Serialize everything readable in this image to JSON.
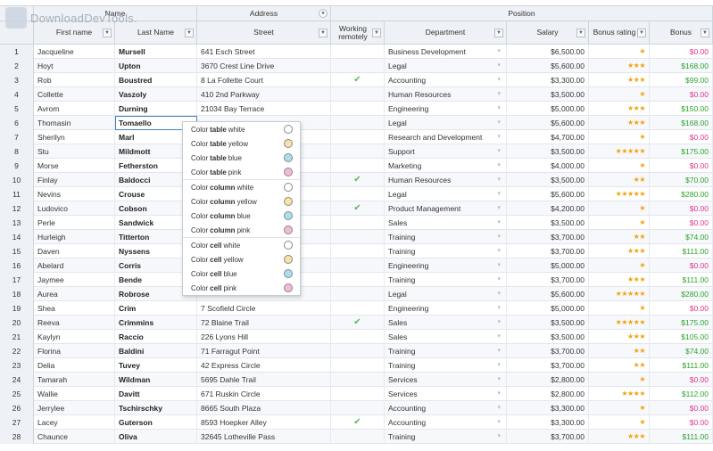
{
  "header": {
    "group_name": "Name",
    "group_address": "Address",
    "group_position": "Position",
    "columns": [
      "First name",
      "Last Name",
      "Street",
      "Working remotely",
      "Department",
      "Salary",
      "Bonus rating",
      "Bonus"
    ]
  },
  "watermark": "DownloadDevTools.",
  "colors": {
    "bonus_positive": "#2aa52a",
    "bonus_zero": "#e0348c",
    "star": "#f0a30a",
    "check": "#5cb85c"
  },
  "rows": [
    {
      "n": "1",
      "first": "Jacqueline",
      "last": "Mursell",
      "street": "641 Esch Street",
      "remote": false,
      "dept": "Business Development",
      "salary": "$6,500.00",
      "stars": "★",
      "bonus": "$0.00"
    },
    {
      "n": "2",
      "first": "Hoyt",
      "last": "Upton",
      "street": "3670 Crest Line Drive",
      "remote": false,
      "dept": "Legal",
      "salary": "$5,600.00",
      "stars": "★★★",
      "bonus": "$168.00"
    },
    {
      "n": "3",
      "first": "Rob",
      "last": "Boustred",
      "street": "8 La Follette Court",
      "remote": true,
      "dept": "Accounting",
      "salary": "$3,300.00",
      "stars": "★★★",
      "bonus": "$99.00"
    },
    {
      "n": "4",
      "first": "Collette",
      "last": "Vaszoly",
      "street": "410 2nd Parkway",
      "remote": false,
      "dept": "Human Resources",
      "salary": "$3,500.00",
      "stars": "★",
      "bonus": "$0.00"
    },
    {
      "n": "5",
      "first": "Avrom",
      "last": "Durning",
      "street": "21034 Bay Terrace",
      "remote": false,
      "dept": "Engineering",
      "salary": "$5,000.00",
      "stars": "★★★",
      "bonus": "$150.00"
    },
    {
      "n": "6",
      "first": "Thomasin",
      "last": "Tomaello",
      "street": "",
      "remote": false,
      "dept": "Legal",
      "salary": "$5,600.00",
      "stars": "★★★",
      "bonus": "$168.00"
    },
    {
      "n": "7",
      "first": "Sherilyn",
      "last": "Marl",
      "street": "",
      "remote": false,
      "dept": "Research and Development",
      "salary": "$4,700.00",
      "stars": "★",
      "bonus": "$0.00"
    },
    {
      "n": "8",
      "first": "Stu",
      "last": "Mildmott",
      "street": "",
      "remote": false,
      "dept": "Support",
      "salary": "$3,500.00",
      "stars": "★★★★★",
      "bonus": "$175.00"
    },
    {
      "n": "9",
      "first": "Morse",
      "last": "Fetherston",
      "street": "",
      "remote": false,
      "dept": "Marketing",
      "salary": "$4,000.00",
      "stars": "★",
      "bonus": "$0.00"
    },
    {
      "n": "10",
      "first": "Finlay",
      "last": "Baldocci",
      "street": "",
      "remote": true,
      "dept": "Human Resources",
      "salary": "$3,500.00",
      "stars": "★★",
      "bonus": "$70.00"
    },
    {
      "n": "11",
      "first": "Nevins",
      "last": "Crouse",
      "street": "",
      "remote": false,
      "dept": "Legal",
      "salary": "$5,600.00",
      "stars": "★★★★★",
      "bonus": "$280.00"
    },
    {
      "n": "12",
      "first": "Ludovico",
      "last": "Cobson",
      "street": "",
      "remote": true,
      "dept": "Product Management",
      "salary": "$4,200.00",
      "stars": "★",
      "bonus": "$0.00"
    },
    {
      "n": "13",
      "first": "Perle",
      "last": "Sandwick",
      "street": "",
      "remote": false,
      "dept": "Sales",
      "salary": "$3,500.00",
      "stars": "★",
      "bonus": "$0.00"
    },
    {
      "n": "14",
      "first": "Hurleigh",
      "last": "Titterton",
      "street": "",
      "remote": false,
      "dept": "Training",
      "salary": "$3,700.00",
      "stars": "★★",
      "bonus": "$74.00"
    },
    {
      "n": "15",
      "first": "Daven",
      "last": "Nyssens",
      "street": "",
      "remote": false,
      "dept": "Training",
      "salary": "$3,700.00",
      "stars": "★★★",
      "bonus": "$111.00"
    },
    {
      "n": "16",
      "first": "Abelard",
      "last": "Corris",
      "street": "",
      "remote": false,
      "dept": "Engineering",
      "salary": "$5,000.00",
      "stars": "★",
      "bonus": "$0.00"
    },
    {
      "n": "17",
      "first": "Jaymee",
      "last": "Bende",
      "street": "",
      "remote": false,
      "dept": "Training",
      "salary": "$3,700.00",
      "stars": "★★★",
      "bonus": "$111.00"
    },
    {
      "n": "18",
      "first": "Aurea",
      "last": "Robrose",
      "street": "",
      "remote": false,
      "dept": "Legal",
      "salary": "$5,600.00",
      "stars": "★★★★★",
      "bonus": "$280.00"
    },
    {
      "n": "19",
      "first": "Shea",
      "last": "Crim",
      "street": "7 Scofield Circle",
      "remote": false,
      "dept": "Engineering",
      "salary": "$5,000.00",
      "stars": "★",
      "bonus": "$0.00"
    },
    {
      "n": "20",
      "first": "Reeva",
      "last": "Crimmins",
      "street": "72 Blaine Trail",
      "remote": true,
      "dept": "Sales",
      "salary": "$3,500.00",
      "stars": "★★★★★",
      "bonus": "$175.00"
    },
    {
      "n": "21",
      "first": "Kaylyn",
      "last": "Raccio",
      "street": "226 Lyons Hill",
      "remote": false,
      "dept": "Sales",
      "salary": "$3,500.00",
      "stars": "★★★",
      "bonus": "$105.00"
    },
    {
      "n": "22",
      "first": "Florina",
      "last": "Baldini",
      "street": "71 Farragut Point",
      "remote": false,
      "dept": "Training",
      "salary": "$3,700.00",
      "stars": "★★",
      "bonus": "$74.00"
    },
    {
      "n": "23",
      "first": "Delia",
      "last": "Tuvey",
      "street": "42 Express Circle",
      "remote": false,
      "dept": "Training",
      "salary": "$3,700.00",
      "stars": "★★",
      "bonus": "$111.00"
    },
    {
      "n": "24",
      "first": "Tamarah",
      "last": "Wildman",
      "street": "5695 Dahle Trail",
      "remote": false,
      "dept": "Services",
      "salary": "$2,800.00",
      "stars": "★",
      "bonus": "$0.00"
    },
    {
      "n": "25",
      "first": "Wallie",
      "last": "Davitt",
      "street": "671 Ruskin Circle",
      "remote": false,
      "dept": "Services",
      "salary": "$2,800.00",
      "stars": "★★★★",
      "bonus": "$112.00"
    },
    {
      "n": "26",
      "first": "Jerrylee",
      "last": "Tschirschky",
      "street": "8665 South Plaza",
      "remote": false,
      "dept": "Accounting",
      "salary": "$3,300.00",
      "stars": "★",
      "bonus": "$0.00"
    },
    {
      "n": "27",
      "first": "Lacey",
      "last": "Guterson",
      "street": "8593 Hoepker Alley",
      "remote": true,
      "dept": "Accounting",
      "salary": "$3,300.00",
      "stars": "★",
      "bonus": "$0.00"
    },
    {
      "n": "28",
      "first": "Chaunce",
      "last": "Oliva",
      "street": "32645 Lotheville Pass",
      "remote": false,
      "dept": "Training",
      "salary": "$3,700.00",
      "stars": "★★★",
      "bonus": "$111.00"
    }
  ],
  "context_menu": {
    "items": [
      {
        "pre": "Color",
        "bold": "table",
        "post": "white",
        "color": "#ffffff"
      },
      {
        "pre": "Color",
        "bold": "table",
        "post": "yellow",
        "color": "#f7e3a6"
      },
      {
        "pre": "Color",
        "bold": "table",
        "post": "blue",
        "color": "#a9e0ec"
      },
      {
        "pre": "Color",
        "bold": "table",
        "post": "pink",
        "color": "#f5b9d8"
      },
      {
        "pre": "Color",
        "bold": "column",
        "post": "white",
        "color": "#ffffff"
      },
      {
        "pre": "Color",
        "bold": "column",
        "post": "yellow",
        "color": "#f7e3a6"
      },
      {
        "pre": "Color",
        "bold": "column",
        "post": "blue",
        "color": "#a9e0ec"
      },
      {
        "pre": "Color",
        "bold": "column",
        "post": "pink",
        "color": "#f5b9d8"
      },
      {
        "pre": "Color",
        "bold": "cell",
        "post": "white",
        "color": "#ffffff"
      },
      {
        "pre": "Color",
        "bold": "cell",
        "post": "yellow",
        "color": "#f7e3a6"
      },
      {
        "pre": "Color",
        "bold": "cell",
        "post": "blue",
        "color": "#a9e0ec"
      },
      {
        "pre": "Color",
        "bold": "cell",
        "post": "pink",
        "color": "#f5b9d8"
      }
    ]
  },
  "selected_row_index": 5,
  "check_glyph": "✔",
  "filter_glyph": "▼",
  "group_glyph": "●"
}
